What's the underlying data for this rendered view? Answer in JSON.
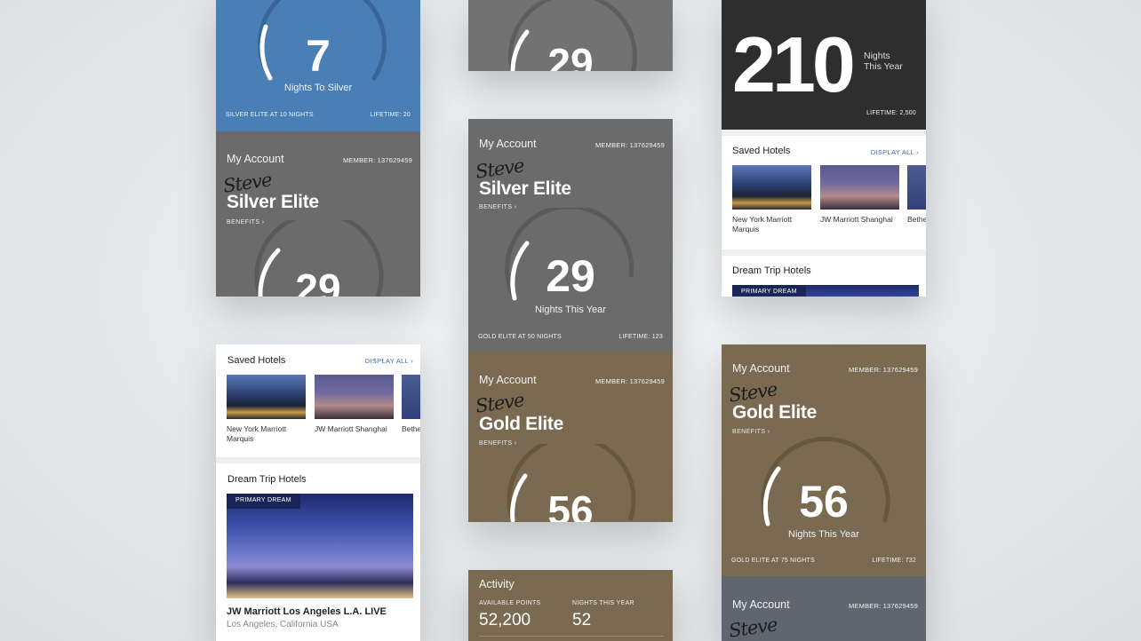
{
  "common": {
    "my_account": "My Account",
    "member": "MEMBER: 137629459",
    "signature": "Steve",
    "benefits": "BENEFITS ›",
    "nights_this_year": "Nights This Year"
  },
  "card_silver_top": {
    "number": "7",
    "label": "Nights To Silver",
    "footer_left": "SILVER ELITE AT 10 NIGHTS",
    "footer_right": "LIFETIME: 20"
  },
  "card_silver_account": {
    "tier": "Silver Elite",
    "number": "29"
  },
  "card_top_middle": {
    "number": "29"
  },
  "card_silver_full": {
    "tier": "Silver Elite",
    "number": "29",
    "footer_left": "GOLD ELITE AT 50 NIGHTS",
    "footer_right": "LIFETIME: 123"
  },
  "card_gold_account": {
    "tier": "Gold Elite",
    "number": "56"
  },
  "card_activity": {
    "title": "Activity",
    "points_label": "AVAILABLE POINTS",
    "points_value": "52,200",
    "nights_label": "NIGHTS THIS YEAR",
    "nights_value": "52"
  },
  "card_dark": {
    "number": "210",
    "label_line1": "Nights",
    "label_line2": "This Year",
    "footer_right": "LIFETIME: 2,500"
  },
  "saved_hotels": {
    "title": "Saved Hotels",
    "display_all": "DISPLAY ALL ›",
    "items": [
      {
        "name": "New York Marriott Marquis"
      },
      {
        "name": "JW Marriott Shanghai"
      },
      {
        "name": "Bethe"
      }
    ]
  },
  "dream_trip": {
    "title": "Dream Trip Hotels",
    "badge": "PRIMARY DREAM",
    "hotel_name": "JW Marriott Los Angeles L.A. LIVE",
    "hotel_location": "Los Angeles, California USA"
  },
  "card_gold_full": {
    "tier": "Gold Elite",
    "number": "56",
    "footer_left": "GOLD ELITE AT 75 NIGHTS",
    "footer_right": "LIFETIME: 732"
  },
  "colors": {
    "blue": "#4a7fb5",
    "grey": "#6b6b6b",
    "gold": "#7a6a52",
    "dark": "#2e2e2e",
    "slate": "#5f6670",
    "link": "#3b6fae"
  }
}
